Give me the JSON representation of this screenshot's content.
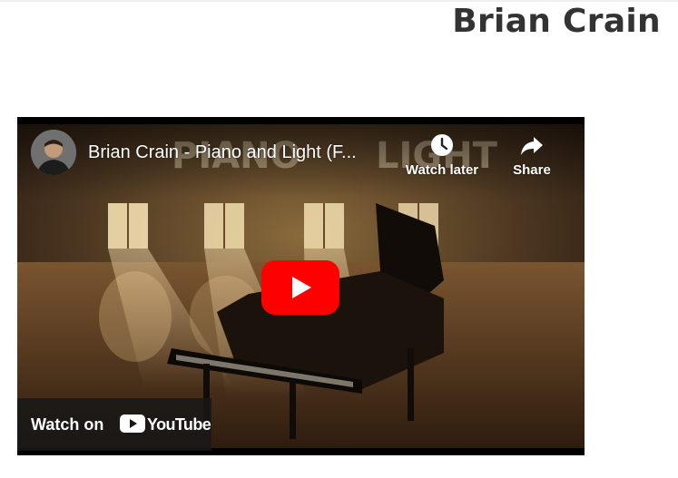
{
  "page": {
    "title": "Brian Crain"
  },
  "video": {
    "title": "Brian Crain - Piano and Light (F...",
    "watch_later_label": "Watch later",
    "share_label": "Share",
    "watch_on_label": "Watch on",
    "youtube_wordmark": "YouTube",
    "thumbnail_text": "PIANO AND LIGHT"
  },
  "icons": [
    "clock-icon",
    "share-icon",
    "play-icon",
    "youtube-logo-icon",
    "channel-avatar"
  ],
  "colors": {
    "play_button": "#ff0000",
    "title_text": "#333333",
    "overlay_text": "#ffffff"
  }
}
